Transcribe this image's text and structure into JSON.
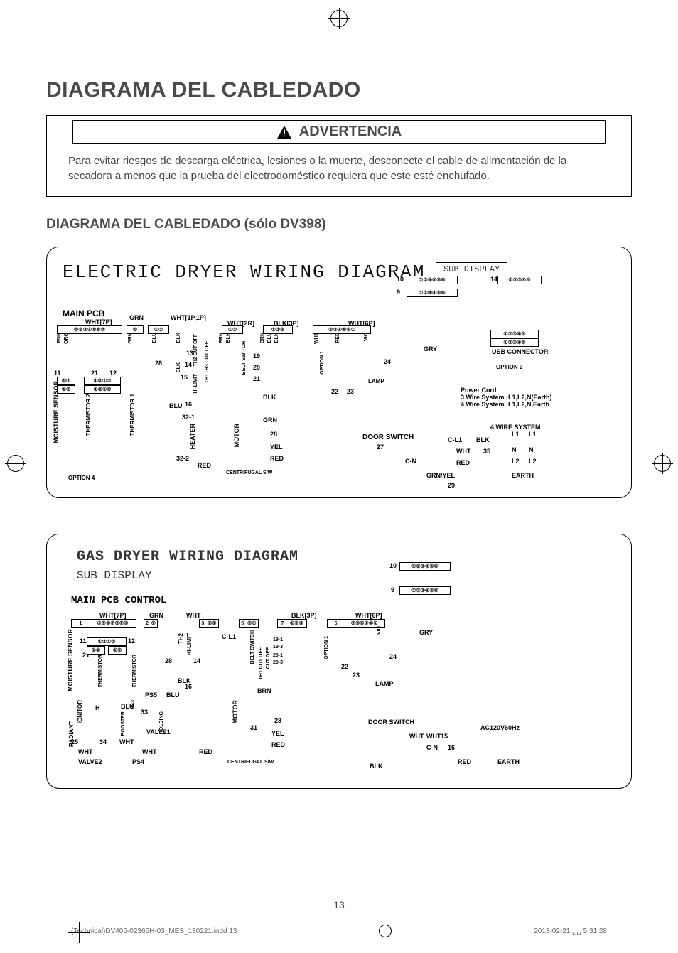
{
  "title": "DIAGRAMA DEL CABLEDADO",
  "warning": {
    "header": "ADVERTENCIA",
    "body": "Para evitar riesgos de descarga eléctrica, lesiones o la muerte, desconecte el cable de alimentación de la secadora a menos que la prueba del electrodoméstico requiera que este esté enchufado."
  },
  "subtitle": "DIAGRAMA DEL CABLEDADO (sólo DV398)",
  "electric": {
    "title": "ELECTRIC DRYER WIRING DIAGRAM",
    "sub_display": "SUB DISPLAY",
    "main_pcb": "MAIN PCB",
    "labels": {
      "wht7p": "WHT[7P]",
      "grn": "GRN",
      "wht1p1p": "WHT[1P,1P]",
      "wht2r": "WHT[2R]",
      "blk3p": "BLK[3P]",
      "wht6p": "WHT[6P]",
      "gry": "GRY",
      "usb": "USB CONNECTOR",
      "option2": "OPTION 2",
      "power_cord": "Power Cord",
      "wire3": "3 Wire System :L1,L2,N(Earth)",
      "wire4": "4 Wire System :L1,L2,N,Earth",
      "four_wire": "4 WIRE SYSTEM",
      "l1": "L1",
      "l1b": "L1",
      "c_l1": "C-L1",
      "blk": "BLK",
      "wht": "WHT",
      "n35": "35",
      "n": "N",
      "c_n": "C-N",
      "red": "RED",
      "l2": "L2",
      "grn_yel": "GRN/YEL",
      "earth": "EARTH",
      "n29": "29",
      "door_switch": "DOOR SWITCH",
      "lamp": "LAMP",
      "n24": "24",
      "n27": "27",
      "moisture": "MOISTURE SENSOR",
      "therm1": "THERMISTOR 1",
      "therm2": "THERMISTOR 2",
      "option4": "OPTION 4",
      "n28": "28",
      "heater": "HEATER",
      "motor": "MOTOR",
      "n14": "14",
      "th2": "TH2 CUT OFF",
      "hilimit": "HI-LIMIT",
      "th3": "TH3 CUT OFF",
      "th1": "TH1",
      "belt": "BELT SWITCH",
      "blu": "BLU",
      "brn": "BRN",
      "n16": "16",
      "n32_1": "32-1",
      "n32_2": "32-2",
      "n19": "19",
      "n20": "20",
      "n21": "21",
      "n11": "11",
      "n12": "12",
      "n13": "13",
      "n15": "15",
      "n22": "22",
      "n23": "23",
      "n10": "10",
      "n9": "9",
      "n14b": "14",
      "yel": "YEL",
      "option1": "OPTION 1",
      "centrifugal": "CENTRIFUGAL S/W",
      "pnk": "PNK",
      "org": "ORG",
      "vio": "VIO"
    }
  },
  "gas": {
    "title": "GAS DRYER WIRING DIAGRAM",
    "sub_display": "SUB DISPLAY",
    "main_pcb": "MAIN PCB CONTROL",
    "labels": {
      "wht7p": "WHT[7P]",
      "grn": "GRN",
      "wht": "WHT",
      "blk3p": "BLK[3P]",
      "wht6p": "WHT[6P]",
      "gry": "GRY",
      "moisture": "MOISTURE SENSOR",
      "therm1": "THERMISTOR",
      "therm2": "THERMISTOR",
      "th2": "TH2",
      "hilimit": "HI-LIMIT",
      "n28": "28",
      "c_l1": "C-L1",
      "n14": "14",
      "ps5": "PS5",
      "blu": "BLU",
      "blk": "BLK",
      "brn": "BRN",
      "n16": "16",
      "n19_1": "19-1",
      "n19_3": "19-3",
      "n20_1": "20-1",
      "n20_3": "20-3",
      "motor": "MOTOR",
      "n31": "31",
      "yel": "YEL",
      "red": "RED",
      "ignitor": "IGNITOR",
      "radiant": "RADIANT",
      "h": "H",
      "n33": "33",
      "booster": "BOOSTER",
      "holding": "HOLDING",
      "valve1": "VALVE1",
      "valve2": "VALVE2",
      "ps4": "PS4",
      "n25": "25",
      "n34": "34",
      "ps3": "PS3",
      "door_switch": "DOOR SWITCH",
      "lamp": "LAMP",
      "n24": "24",
      "n22": "22",
      "n23": "23",
      "vio": "VIO",
      "ac": "AC120V60Hz",
      "n15": "15",
      "c_n": "C-N",
      "n16b": "16",
      "earth": "EARTH",
      "centrifugal": "CENTRIFUGAL S/W",
      "n10": "10",
      "n9": "9",
      "n11": "11",
      "n12": "12",
      "n21": "21",
      "belt": "BELT SWITCH",
      "th1": "TH1 CUT OFF",
      "option1": "OPTION 1",
      "cut": "CUT OFF"
    }
  },
  "page_number": "13",
  "footer": {
    "file": "(Technical)DV405-02365H-03_MES_130221.indd   13",
    "timestamp": "2013-02-21   ␣␣ 5:31:28"
  }
}
